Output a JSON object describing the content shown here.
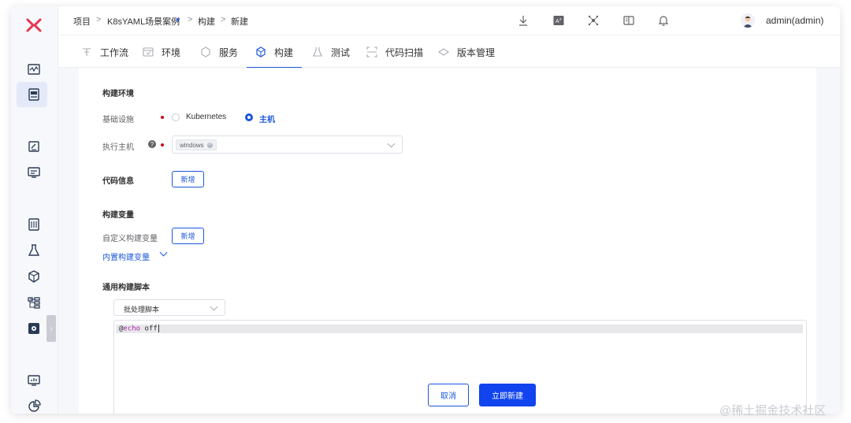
{
  "breadcrumb": {
    "root": "项目",
    "sep1": ">",
    "project": "K8sYAML场景案例",
    "sep2": ">",
    "section": "构建",
    "sep3": ">",
    "current": "新建"
  },
  "header": {
    "user": "admin(admin)",
    "icons": [
      "download-icon",
      "translate-icon",
      "integration-icon",
      "book-icon",
      "bell-icon"
    ]
  },
  "tabs": [
    {
      "label": "工作流",
      "icon": "workflow-icon"
    },
    {
      "label": "环境",
      "icon": "environment-icon"
    },
    {
      "label": "服务",
      "icon": "service-icon"
    },
    {
      "label": "构建",
      "icon": "build-icon",
      "active": true
    },
    {
      "label": "测试",
      "icon": "test-icon"
    },
    {
      "label": "代码扫描",
      "icon": "scan-icon"
    },
    {
      "label": "版本管理",
      "icon": "version-icon"
    }
  ],
  "build_env": {
    "title": "构建环境",
    "infra_label": "基础设施",
    "option_k8s": "Kubernetes",
    "option_host": "主机",
    "host_label": "执行主机",
    "host_tag": "windows"
  },
  "code_info": {
    "title": "代码信息",
    "add_label": "新增"
  },
  "build_vars": {
    "title": "构建变量",
    "custom_label": "自定义构建变量",
    "add_label": "新增",
    "builtin_link": "内置构建变量"
  },
  "script": {
    "title": "通用构建脚本",
    "type_value": "批处理脚本",
    "code_at": "@",
    "code_keyword": "echo",
    "code_rest": " off"
  },
  "actions": {
    "cancel": "取消",
    "create": "立即新建"
  },
  "watermark": "@稀土掘金技术社区",
  "colors": {
    "accent": "#1a56db",
    "primary_button": "#1144ee",
    "required": "#d0021b"
  }
}
